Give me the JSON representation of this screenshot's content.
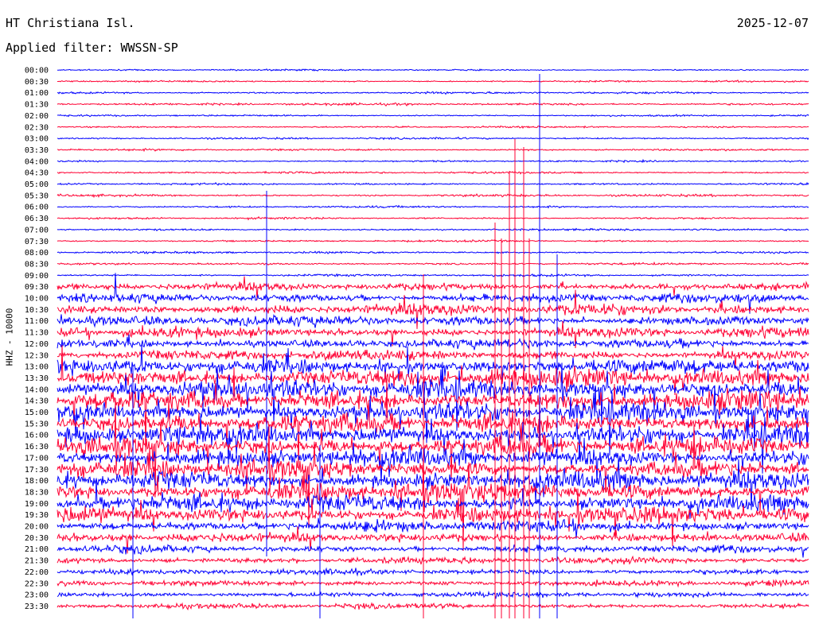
{
  "header": {
    "station": "HT Christiana Isl.",
    "date": "2025-12-07",
    "filter_label": "Applied filter: WWSSN-SP"
  },
  "colors": {
    "trace_blue": "#0000ff",
    "trace_red": "#ff0033",
    "background": "#ffffff",
    "text": "#000000"
  },
  "chart_data": {
    "type": "line",
    "title": "HT Christiana Isl.",
    "ylabel": "HHZ - 10000",
    "xlabel": "",
    "grid": false,
    "legend": "none",
    "series_colors": [
      "#0000ff",
      "#ff0033"
    ],
    "row_times": [
      "00:00",
      "00:30",
      "01:00",
      "01:30",
      "02:00",
      "02:30",
      "03:00",
      "03:30",
      "04:00",
      "04:30",
      "05:00",
      "05:30",
      "06:00",
      "06:30",
      "07:00",
      "07:30",
      "08:00",
      "08:30",
      "09:00",
      "09:30",
      "10:00",
      "10:30",
      "11:00",
      "11:30",
      "12:00",
      "12:30",
      "13:00",
      "13:30",
      "14:00",
      "14:30",
      "15:00",
      "15:30",
      "16:00",
      "16:30",
      "17:00",
      "17:30",
      "18:00",
      "18:30",
      "19:00",
      "19:30",
      "20:00",
      "20:30",
      "21:00",
      "21:30",
      "22:00",
      "22:30",
      "23:00",
      "23:30"
    ],
    "row_activity": [
      0.02,
      0.03,
      0.05,
      0.06,
      0.03,
      0.03,
      0.04,
      0.04,
      0.03,
      0.05,
      0.04,
      0.06,
      0.04,
      0.04,
      0.04,
      0.04,
      0.05,
      0.05,
      0.06,
      0.35,
      0.45,
      0.55,
      0.5,
      0.5,
      0.45,
      0.5,
      0.75,
      0.95,
      1.0,
      1.0,
      1.0,
      1.0,
      1.0,
      1.0,
      0.95,
      0.9,
      0.95,
      0.9,
      0.85,
      0.8,
      0.55,
      0.45,
      0.35,
      0.3,
      0.25,
      0.25,
      0.22,
      0.22
    ]
  }
}
